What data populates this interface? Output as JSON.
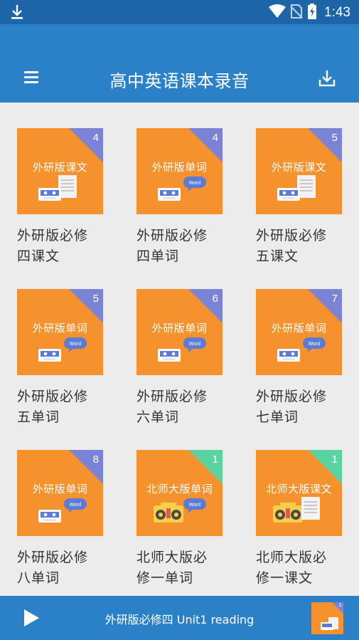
{
  "status": {
    "time": "1:43"
  },
  "app_bar": {
    "title": "高中英语课本录音"
  },
  "books": [
    {
      "label": "外研版必修四课文",
      "line1": "外研版必修",
      "line2": "四课文",
      "cover_title": "外研版课文",
      "badge": "4",
      "corner": "#7b83d6",
      "art": "text"
    },
    {
      "label": "外研版必修四单词",
      "line1": "外研版必修",
      "line2": "四单词",
      "cover_title": "外研版单词",
      "badge": "4",
      "corner": "#7b83d6",
      "art": "word"
    },
    {
      "label": "外研版必修五课文",
      "line1": "外研版必修",
      "line2": "五课文",
      "cover_title": "外研版课文",
      "badge": "5",
      "corner": "#7b83d6",
      "art": "text"
    },
    {
      "label": "外研版必修五单词",
      "line1": "外研版必修",
      "line2": "五单词",
      "cover_title": "外研版单词",
      "badge": "5",
      "corner": "#7b83d6",
      "art": "word"
    },
    {
      "label": "外研版必修六单词",
      "line1": "外研版必修",
      "line2": "六单词",
      "cover_title": "外研版单词",
      "badge": "6",
      "corner": "#7b83d6",
      "art": "word"
    },
    {
      "label": "外研版必修七单词",
      "line1": "外研版必修",
      "line2": "七单词",
      "cover_title": "外研版单词",
      "badge": "7",
      "corner": "#7b83d6",
      "art": "word"
    },
    {
      "label": "外研版必修八单词",
      "line1": "外研版必修",
      "line2": "八单词",
      "cover_title": "外研版单词",
      "badge": "8",
      "corner": "#7b83d6",
      "art": "word"
    },
    {
      "label": "北师大版必修一单词",
      "line1": "北师大版必",
      "line2": "修一单词",
      "cover_title": "北师大版单词",
      "badge": "1",
      "corner": "#5bd3a0",
      "art": "radio-word"
    },
    {
      "label": "北师大版必修一课文",
      "line1": "北师大版必",
      "line2": "修一课文",
      "cover_title": "北师大版课文",
      "badge": "1",
      "corner": "#5bd3a0",
      "art": "radio-text"
    }
  ],
  "art_text": {
    "word": "Word"
  },
  "player": {
    "now_playing": "外研版必修四 Unit1 reading",
    "thumb_badge": "1"
  },
  "colors": {
    "status_bar": "#1d65a7",
    "app_bar": "#2b81c8",
    "cover": "#f5922d",
    "corner_blue": "#7b83d6",
    "corner_green": "#5bd3a0"
  }
}
